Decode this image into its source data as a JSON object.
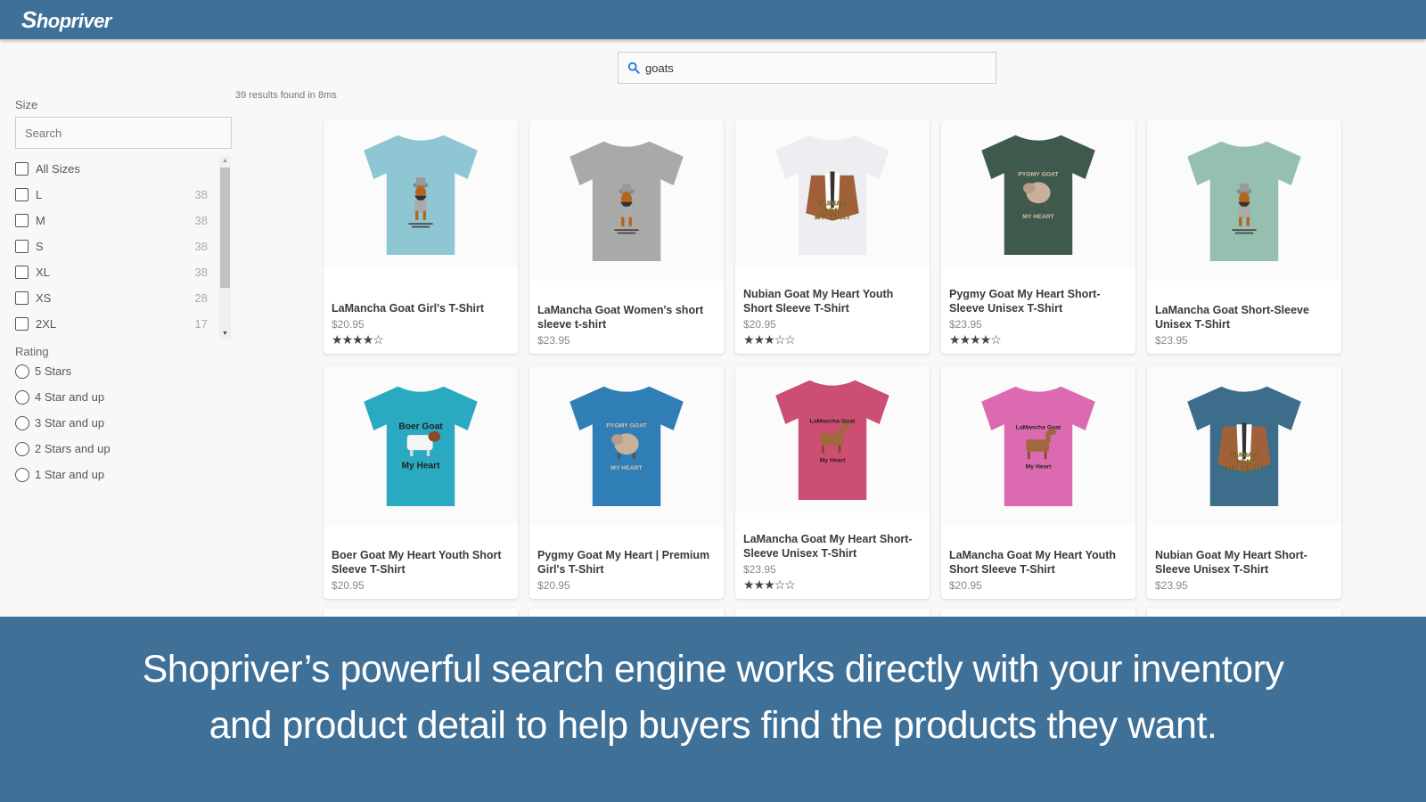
{
  "header": {
    "logo_text": "hopriver",
    "logo_initial": "S",
    "brand_color": "#3e7098"
  },
  "search": {
    "icon": "search-icon",
    "value": "goats",
    "icon_color": "#1a73e8"
  },
  "results": {
    "summary": "39 results found in 8ms"
  },
  "sidebar": {
    "size_facet": {
      "title": "Size",
      "search_placeholder": "Search",
      "items": [
        {
          "label": "All Sizes",
          "count": ""
        },
        {
          "label": "L",
          "count": "38"
        },
        {
          "label": "M",
          "count": "38"
        },
        {
          "label": "S",
          "count": "38"
        },
        {
          "label": "XL",
          "count": "38"
        },
        {
          "label": "XS",
          "count": "28"
        },
        {
          "label": "2XL",
          "count": "17"
        }
      ]
    },
    "rating_facet": {
      "title": "Rating",
      "items": [
        {
          "label": "5 Stars"
        },
        {
          "label": "4 Star and up"
        },
        {
          "label": "3 Star and up"
        },
        {
          "label": "2 Stars and up"
        },
        {
          "label": "1 Star and up"
        }
      ]
    }
  },
  "products": [
    {
      "title": "LaMancha Goat Girl's T-Shirt",
      "price": "$20.95",
      "rating": 4,
      "shirt_color": "#8ec6d4",
      "print": "lamancha-cartoon"
    },
    {
      "title": "LaMancha Goat Women's short sleeve t-shirt",
      "price": "$23.95",
      "rating": null,
      "shirt_color": "#a9a9a9",
      "print": "lamancha-cartoon"
    },
    {
      "title": "Nubian Goat My Heart Youth Short Sleeve T-Shirt",
      "price": "$20.95",
      "rating": 3,
      "shirt_color": "#eeeef2",
      "print": "nubian-head"
    },
    {
      "title": "Pygmy Goat My Heart Short-Sleeve Unisex T-Shirt",
      "price": "$23.95",
      "rating": 4,
      "shirt_color": "#3e5a4c",
      "print": "pygmy"
    },
    {
      "title": "LaMancha Goat Short-Sleeve Unisex T-Shirt",
      "price": "$23.95",
      "rating": null,
      "shirt_color": "#95c0b0",
      "print": "lamancha-cartoon"
    },
    {
      "title": "Boer Goat My Heart Youth Short Sleeve T-Shirt",
      "price": "$20.95",
      "rating": null,
      "shirt_color": "#2aaac0",
      "print": "boer"
    },
    {
      "title": "Pygmy Goat My Heart | Premium Girl's T-Shirt",
      "price": "$20.95",
      "rating": null,
      "shirt_color": "#2f7fb6",
      "print": "pygmy"
    },
    {
      "title": "LaMancha Goat My Heart Short-Sleeve Unisex T-Shirt",
      "price": "$23.95",
      "rating": 3,
      "shirt_color": "#cc4e72",
      "print": "lamancha-heart"
    },
    {
      "title": "LaMancha Goat My Heart Youth Short Sleeve T-Shirt",
      "price": "$20.95",
      "rating": null,
      "shirt_color": "#dc6ab0",
      "print": "lamancha-heart"
    },
    {
      "title": "Nubian Goat My Heart Short-Sleeve Unisex T-Shirt",
      "price": "$23.95",
      "rating": null,
      "shirt_color": "#3c6e8c",
      "print": "nubian-head"
    }
  ],
  "banner": {
    "line1": "Shopriver’s powerful search engine works directly with your inventory",
    "line2": "and product detail to help buyers find the products they want."
  }
}
